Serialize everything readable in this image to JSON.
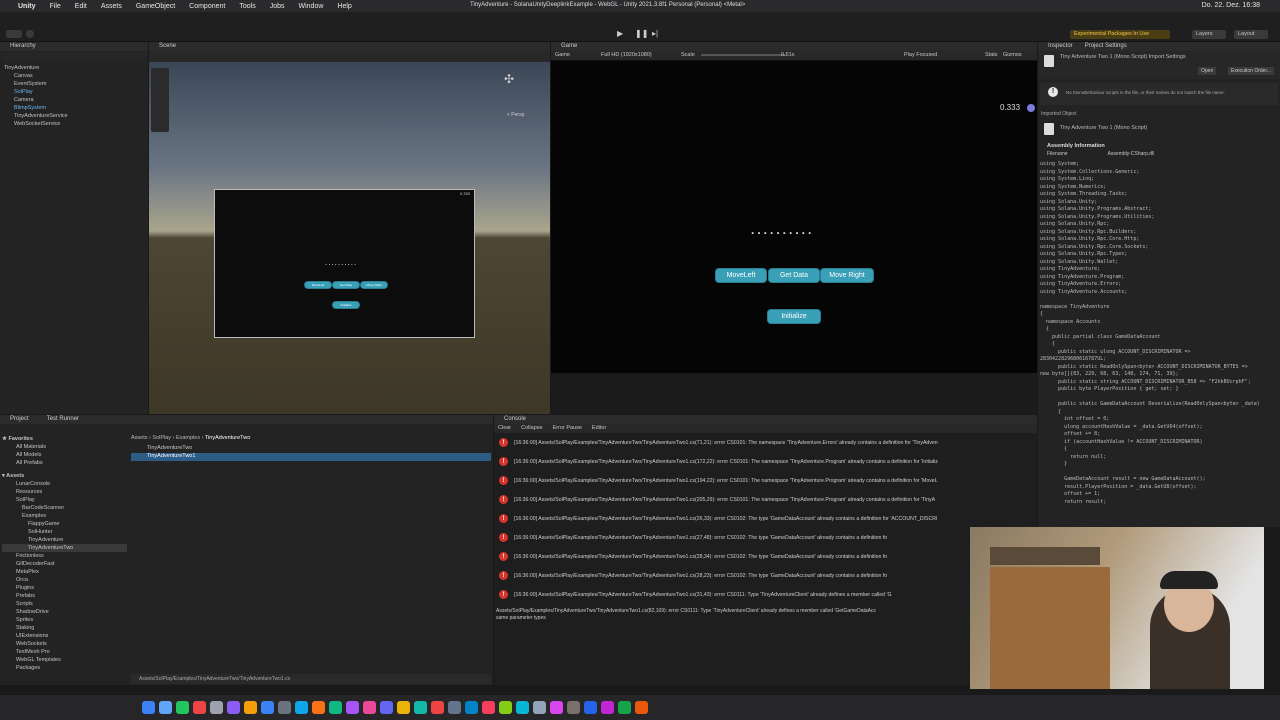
{
  "menubar": {
    "app": "Unity",
    "items": [
      "File",
      "Edit",
      "Assets",
      "GameObject",
      "Component",
      "Tools",
      "Jobs",
      "Window",
      "Help"
    ],
    "title": "TinyAdventure - SolanaUnityDeeplinkExample - WebGL - Unity 2021.3.8f1 Personal (Personal) <Metal>",
    "clock": "Do. 22. Dez. 16:38"
  },
  "toolbar": {
    "experimental": "Experimental Packages In Use",
    "layers": "Layers",
    "layout": "Layout"
  },
  "hierarchy": {
    "tab": "Hierarchy",
    "items": [
      {
        "label": "TinyAdventure",
        "indent": 0,
        "selected": false
      },
      {
        "label": "Canvas",
        "indent": 1,
        "selected": false
      },
      {
        "label": "EventSystem",
        "indent": 1,
        "selected": false
      },
      {
        "label": "SolPlay",
        "indent": 1,
        "selected": false
      },
      {
        "label": "Camera",
        "indent": 1,
        "selected": false
      },
      {
        "label": "BlimpSystem",
        "indent": 1,
        "selected": false
      },
      {
        "label": "TinyAdventureService",
        "indent": 1,
        "selected": false
      },
      {
        "label": "WebSocketService",
        "indent": 1,
        "selected": false
      }
    ]
  },
  "scene": {
    "tab": "Scene",
    "persp": "< Persp",
    "buttons": [
      "MoveLeft",
      "Get Data",
      "Move Right"
    ],
    "init": "Initialize",
    "counter": "0.333"
  },
  "game": {
    "tab": "Game",
    "display": "Game",
    "resolution": "Full HD (1920x1080)",
    "scale_label": "Scale",
    "scale_value": "0.51x",
    "play_focused": "Play Focused",
    "stats": "Stats",
    "gizmos": "Gizmos",
    "counter": "0.333",
    "dots": "..........",
    "buttons": [
      "MoveLeft",
      "Get Data",
      "Move Right"
    ],
    "init": "Initialize"
  },
  "inspector": {
    "tab": "Inspector",
    "tab2": "Project Settings",
    "title": "Tiny Adventure Two 1 (Mono Script) Import Settings",
    "open": "Open",
    "exec_order": "Execution Order...",
    "warning": "No MonoBehaviour scripts in the file, or their names do not match the file name.",
    "imported_object": "Imported Object",
    "script_name": "Tiny Adventure Two 1 (Mono Script)",
    "assembly_info": "Assembly Information",
    "filename_label": "Filename",
    "filename_value": "Assembly-CSharp.dll",
    "code": "using System;\nusing System.Collections.Generic;\nusing System.Linq;\nusing System.Numerics;\nusing System.Threading.Tasks;\nusing Solana.Unity;\nusing Solana.Unity.Programs.Abstract;\nusing Solana.Unity.Programs.Utilities;\nusing Solana.Unity.Rpc;\nusing Solana.Unity.Rpc.Builders;\nusing Solana.Unity.Rpc.Core.Http;\nusing Solana.Unity.Rpc.Core.Sockets;\nusing Solana.Unity.Rpc.Types;\nusing Solana.Unity.Wallet;\nusing TinyAdventure;\nusing TinyAdventure.Program;\nusing TinyAdventure.Errors;\nusing TinyAdventure.Accounts;\n\nnamespace TinyAdventure\n{\n  namespace Accounts\n  {\n    public partial class GameDataAccount\n    {\n      public static ulong ACCOUNT_DISCRIMINATOR =>\n2830422829680616787UL;\n      public static ReadOnlySpan<byte> ACCOUNT_DISCRIMINATOR_BYTES =>\nnew byte[]{83, 229, 68, 63, 148, 174, 71, 39};\n      public static string ACCOUNT_DISCRIMINATOR_B58 => \"F2hkBUcrphF\";\n      public byte PlayerPosition { get; set; }\n\n      public static GameDataAccount Deserialize(ReadOnlySpan<byte> _data)\n      {\n        int offset = 0;\n        ulong accountHashValue = _data.GetU64(offset);\n        offset += 8;\n        if (accountHashValue != ACCOUNT_DISCRIMINATOR)\n        {\n          return null;\n        }\n\n        GameDataAccount result = new GameDataAccount();\n        result.PlayerPosition = _data.GetU8(offset);\n        offset += 1;\n        return result;"
  },
  "project": {
    "tab": "Project",
    "tab2": "Test Runner",
    "favorites": "Favorites",
    "fav_items": [
      "All Materials",
      "All Models",
      "All Prefabs"
    ],
    "assets": "Assets",
    "tree": [
      "LunarConsole",
      "Resources",
      "SolPlay",
      "BarCodeScanner",
      "Examples",
      "FlappyGame",
      "SolHunter",
      "TinyAdventure",
      "TinyAdventureTwo",
      "Frictionless",
      "GifDecoderFast",
      "MetaPlex",
      "Orca",
      "Plugins",
      "Prefabs",
      "Scripts",
      "ShadowDrive",
      "Sprites",
      "Staking",
      "UIExtensions",
      "WebSockets",
      "TextMesh Pro",
      "WebGL Templates",
      "Packages"
    ],
    "breadcrumb": [
      "Assets",
      "SolPlay",
      "Examples",
      "TinyAdventureTwo"
    ],
    "files": [
      "TinyAdventureTwo",
      "TinyAdventureTwo1"
    ],
    "footer_path": "Assets/SolPlay/Examples/TinyAdventureTwo/TinyAdventureTwo1.cs"
  },
  "console": {
    "tab": "Console",
    "clear": "Clear",
    "collapse": "Collapse",
    "error_pause": "Error Pause",
    "editor": "Editor",
    "entries": [
      "[16:36:00] Assets/SolPlay/Examples/TinyAdventureTwo/TinyAdventureTwo1.cs(71,21): error CS0101: The namespace 'TinyAdventure.Errors' already contains a definition for 'TinyAdven",
      "[16:36:00] Assets/SolPlay/Examples/TinyAdventureTwo/TinyAdventureTwo1.cs(172,22): error CS0101: The namespace 'TinyAdventure.Program' already contains a definition for 'Initializ",
      "[16:36:00] Assets/SolPlay/Examples/TinyAdventureTwo/TinyAdventureTwo1.cs(194,22): error CS0101: The namespace 'TinyAdventure.Program' already contains a definition for 'MoveL",
      "[16:36:00] Assets/SolPlay/Examples/TinyAdventureTwo/TinyAdventureTwo1.cs(205,29): error CS0101: The namespace 'TinyAdventure.Program' already contains a definition for 'TinyA",
      "[16:36:00] Assets/SolPlay/Examples/TinyAdventureTwo/TinyAdventureTwo1.cs(26,33): error CS0102: The type 'GameDataAccount' already contains a definition for 'ACCOUNT_DISCRI",
      "[16:36:00] Assets/SolPlay/Examples/TinyAdventureTwo/TinyAdventureTwo1.cs(27,48): error CS0102: The type 'GameDataAccount' already contains a definition fo",
      "[16:36:00] Assets/SolPlay/Examples/TinyAdventureTwo/TinyAdventureTwo1.cs(28,34): error CS0102: The type 'GameDataAccount' already contains a definition fo",
      "[16:36:00] Assets/SolPlay/Examples/TinyAdventureTwo/TinyAdventureTwo1.cs(28,23): error CS0102: The type 'GameDataAccount' already contains a definition fo",
      "[16:36:00] Assets/SolPlay/Examples/TinyAdventureTwo/TinyAdventureTwo1.cs(31,43): error CS0111: Type 'TinyAdventureClient' already defines a member called 'G"
    ],
    "detail": "Assets/SolPlay/Examples/TinyAdventureTwo/TinyAdventureTwo1.cs(82,109): error CS0111: Type 'TinyAdventureClient' already defines a member called 'GetGameDataAcc\nsame parameter types"
  },
  "colors": {
    "accent": "#3aa0b8",
    "error": "#d9332d",
    "selection": "#2c5d87"
  }
}
